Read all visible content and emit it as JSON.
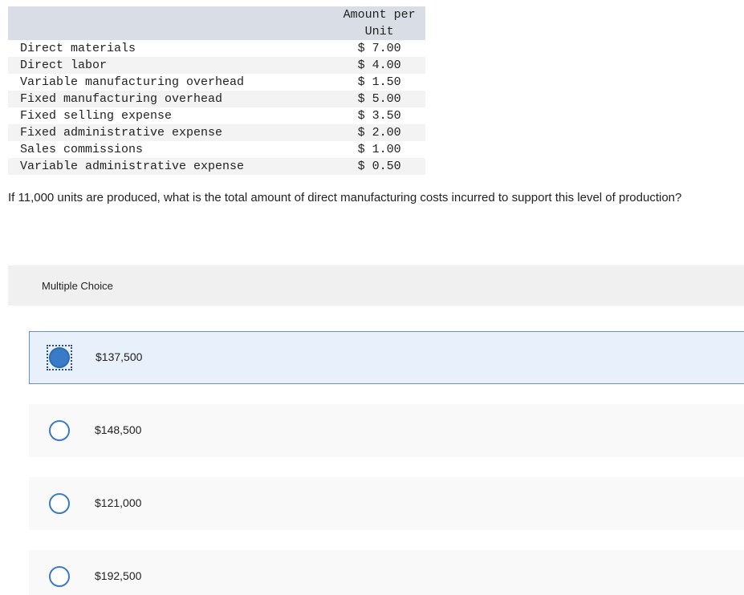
{
  "table": {
    "header_line1": "Amount per",
    "header_line2": "Unit",
    "rows": [
      {
        "label": "Direct materials",
        "amount": "$ 7.00"
      },
      {
        "label": "Direct labor",
        "amount": "$ 4.00"
      },
      {
        "label": "Variable manufacturing overhead",
        "amount": "$ 1.50"
      },
      {
        "label": "Fixed manufacturing overhead",
        "amount": "$ 5.00"
      },
      {
        "label": "Fixed selling expense",
        "amount": "$ 3.50"
      },
      {
        "label": "Fixed administrative expense",
        "amount": "$ 2.00"
      },
      {
        "label": "Sales commissions",
        "amount": "$ 1.00"
      },
      {
        "label": "Variable administrative expense",
        "amount": "$ 0.50"
      }
    ]
  },
  "question": "If 11,000 units are produced, what is the total amount of direct manufacturing costs incurred to support this level of production?",
  "multiple_choice": {
    "header": "Multiple Choice",
    "options": [
      {
        "label": "$137,500",
        "selected": true
      },
      {
        "label": "$148,500",
        "selected": false
      },
      {
        "label": "$121,000",
        "selected": false
      },
      {
        "label": "$192,500",
        "selected": false
      }
    ]
  },
  "colors": {
    "header_bg": "#d9dee6",
    "radio_blue": "#3a7bc8",
    "selected_bg": "#e8f0fb"
  }
}
